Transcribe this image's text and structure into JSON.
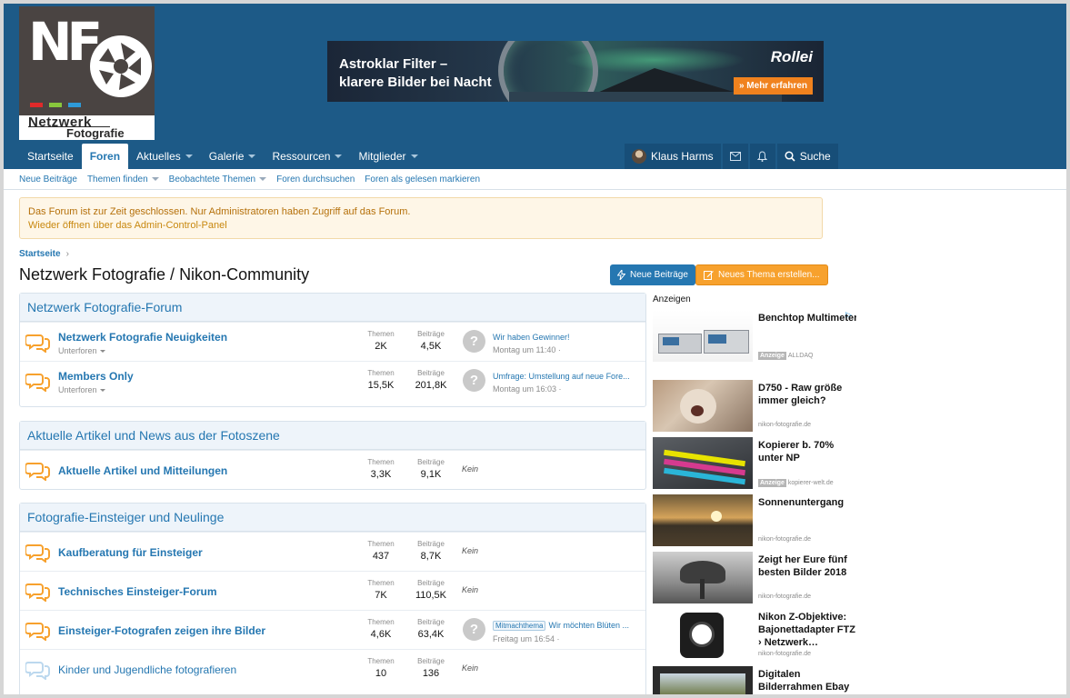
{
  "logo": {
    "letters": "NF",
    "line1": "Netzwerk",
    "line2": "Fotografie",
    "bar_colors": [
      "#e02a2a",
      "#88c63c",
      "#2e9ad8"
    ]
  },
  "banner": {
    "headline1": "Astroklar Filter –",
    "headline2": "klarere Bilder bei Nacht",
    "brand": "Rollei",
    "cta": "» Mehr erfahren"
  },
  "nav": {
    "tabs": [
      {
        "label": "Startseite",
        "dropdown": false
      },
      {
        "label": "Foren",
        "active": true,
        "dropdown": false
      },
      {
        "label": "Aktuelles",
        "dropdown": true
      },
      {
        "label": "Galerie",
        "dropdown": true
      },
      {
        "label": "Ressourcen",
        "dropdown": true
      },
      {
        "label": "Mitglieder",
        "dropdown": true
      }
    ],
    "user": "Klaus Harms",
    "search": "Suche"
  },
  "subnav": [
    "Neue Beiträge",
    "Themen finden",
    "Beobachtete Themen",
    "Foren durchsuchen",
    "Foren als gelesen markieren"
  ],
  "notice": {
    "line1": "Das Forum ist zur Zeit geschlossen. Nur Administratoren haben Zugriff auf das Forum.",
    "line2": "Wieder öffnen über das Admin-Control-Panel"
  },
  "breadcrumb": {
    "home": "Startseite",
    "sep": "›"
  },
  "page_title": "Netzwerk Fotografie / Nikon-Community",
  "buttons": {
    "new_posts": "Neue Beiträge",
    "new_thread": "Neues Thema erstellen..."
  },
  "labels": {
    "threads": "Themen",
    "posts": "Beiträge",
    "subforums": "Unterforen",
    "none": "Kein",
    "unknown_avatar": "?"
  },
  "categories": [
    {
      "title": "Netzwerk Fotografie-Forum",
      "forums": [
        {
          "name": "Netzwerk Fotografie Neuigkeiten",
          "subforums": true,
          "threads": "2K",
          "posts": "4,5K",
          "last_title": "Wir haben Gewinner!",
          "last_date": "Montag um 11:40 ·"
        },
        {
          "name": "Members Only",
          "subforums": true,
          "threads": "15,5K",
          "posts": "201,8K",
          "last_title": "Umfrage: Umstellung auf neue Fore...",
          "last_date": "Montag um 16:03 ·"
        }
      ]
    },
    {
      "title": "Aktuelle Artikel und News aus der Fotoszene",
      "forums": [
        {
          "name": "Aktuelle Artikel und Mitteilungen",
          "threads": "3,3K",
          "posts": "9,1K"
        }
      ]
    },
    {
      "title": "Fotografie-Einsteiger und Neulinge",
      "forums": [
        {
          "name": "Kaufberatung für Einsteiger",
          "threads": "437",
          "posts": "8,7K"
        },
        {
          "name": "Technisches Einsteiger-Forum",
          "threads": "7K",
          "posts": "110,5K"
        },
        {
          "name": "Einsteiger-Fotografen zeigen ihre Bilder",
          "threads": "4,6K",
          "posts": "63,4K",
          "last_tag": "Mitmachthema",
          "last_title": "Wir möchten Blüten ...",
          "last_date": "Freitag um 16:54 ·"
        },
        {
          "name": "Kinder und Jugendliche fotografieren",
          "threads": "10",
          "posts": "136",
          "read": true
        }
      ]
    }
  ],
  "ads": {
    "label": "Anzeigen",
    "badge": "Anzeige",
    "items": [
      {
        "headline": "Benchtop Multimeter",
        "source": "ALLDAQ",
        "sponsored": true
      },
      {
        "headline": "D750 - Raw größe immer gleich?",
        "source": "nikon-fotografie.de"
      },
      {
        "headline": "Kopierer b. 70% unter NP",
        "source": "kopierer-welt.de",
        "sponsored": true
      },
      {
        "headline": "Sonnenuntergang",
        "source": "nikon-fotografie.de"
      },
      {
        "headline": "Zeigt her Eure fünf besten Bilder 2018",
        "source": "nikon-fotografie.de"
      },
      {
        "headline": "Nikon Z-Objektive: Bajonettadapter FTZ › Netzwerk…",
        "source": "nikon-fotografie.de"
      },
      {
        "headline": "Digitalen Bilderrahmen Ebay kaufen",
        "source": ""
      }
    ]
  },
  "colors": {
    "header": "#1d5a87",
    "link": "#2577b1",
    "orange": "#f7a12d",
    "notice_bg": "#fef6e7",
    "notice_text": "#b5700a"
  }
}
